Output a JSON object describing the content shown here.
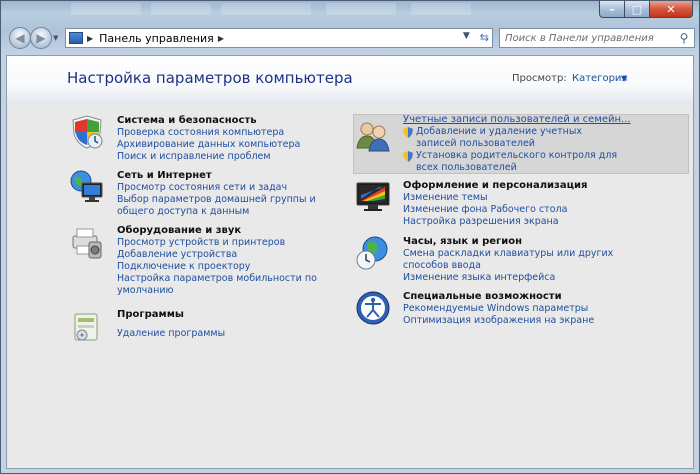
{
  "window": {
    "caption_buttons": {
      "minimize": "–",
      "maximize": "□",
      "close": "✕"
    }
  },
  "navigation": {
    "address_path": "Панель управления",
    "search_placeholder": "Поиск в Панели управления"
  },
  "header": {
    "title": "Настройка параметров компьютера",
    "view_label": "Просмотр:",
    "view_value": "Категория"
  },
  "categories_left": [
    {
      "title": "Система и безопасность",
      "icon": "shield-icon",
      "links": [
        "Проверка состояния компьютера",
        "Архивирование данных компьютера",
        "Поиск и исправление проблем"
      ]
    },
    {
      "title": "Сеть и Интернет",
      "icon": "network-globe-icon",
      "links": [
        "Просмотр состояния сети и задач",
        "Выбор параметров домашней группы и общего доступа к данным"
      ]
    },
    {
      "title": "Оборудование и звук",
      "icon": "printer-icon",
      "links": [
        "Просмотр устройств и принтеров",
        "Добавление устройства",
        "Подключение к проектору",
        "Настройка параметров мобильности по умолчанию"
      ]
    },
    {
      "title": "Программы",
      "icon": "programs-box-icon",
      "links": [
        "Удаление программы"
      ]
    }
  ],
  "categories_right": [
    {
      "title": "Учетные записи пользователей и семейн...",
      "icon": "users-icon",
      "links": [
        "Добавление и удаление учетных записей пользователей",
        "Установка родительского контроля для всех пользователей"
      ]
    },
    {
      "title": "Оформление и персонализация",
      "icon": "monitor-colors-icon",
      "links": [
        "Изменение темы",
        "Изменение фона Рабочего стола",
        "Настройка разрешения экрана"
      ]
    },
    {
      "title": "Часы, язык и регион",
      "icon": "clock-globe-icon",
      "links": [
        "Смена раскладки клавиатуры или других способов ввода",
        "Изменение языка интерфейса"
      ]
    },
    {
      "title": "Специальные возможности",
      "icon": "accessibility-icon",
      "links": [
        "Рекомендуемые Windows параметры",
        "Оптимизация изображения на экране"
      ]
    }
  ]
}
